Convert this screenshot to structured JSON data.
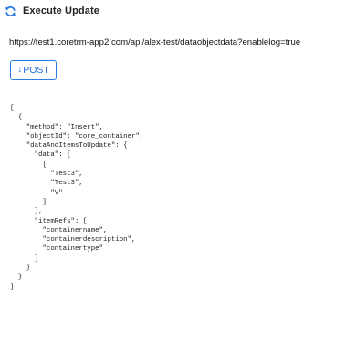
{
  "header": {
    "title": "Execute Update",
    "icon": "refresh-icon",
    "accent": "#2b7de0"
  },
  "request": {
    "url": "https://test1.coretrm-app2.com/api/alex-test/dataobjectdata?enablelog=true",
    "method_label": "POST",
    "method_icon": "arrow-down-icon"
  },
  "body_lines": [
    "[",
    "  {",
    "    \"method\": \"Insert\",",
    "    \"objectId\": \"core_container\",",
    "    \"dataAndItemsToUpdate\": {",
    "      \"data\": [",
    "        [",
    "          \"Test3\",",
    "          \"Test3\",",
    "          \"V\"",
    "        ]",
    "      ],",
    "      \"itemRefs\": [",
    "        \"containername\",",
    "        \"containerdescription\",",
    "        \"containertype\"",
    "      ]",
    "    }",
    "  }",
    "]"
  ]
}
